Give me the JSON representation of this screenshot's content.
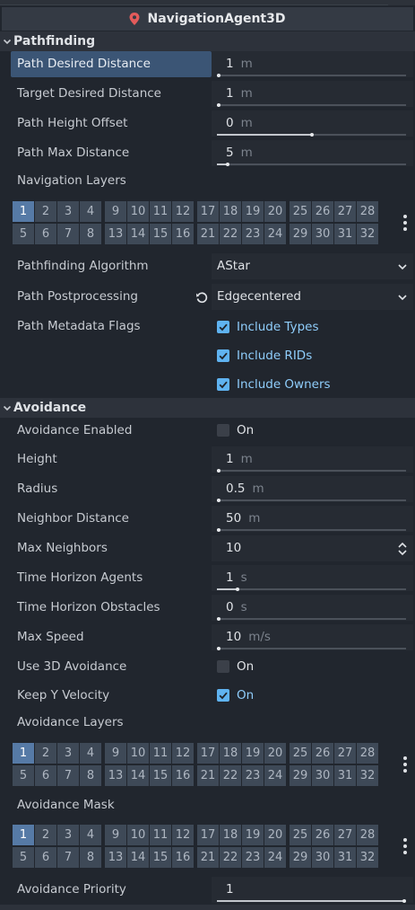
{
  "title": "NavigationAgent3D",
  "sections": {
    "pathfinding": "Pathfinding",
    "avoidance": "Avoidance"
  },
  "pathfinding": {
    "path_desired_distance": {
      "label": "Path Desired Distance",
      "value": "1",
      "unit": "m",
      "fraction": 0.0
    },
    "target_desired_distance": {
      "label": "Target Desired Distance",
      "value": "1",
      "unit": "m",
      "fraction": 0.0
    },
    "path_height_offset": {
      "label": "Path Height Offset",
      "value": "0",
      "unit": "m",
      "fraction": 0.5
    },
    "path_max_distance": {
      "label": "Path Max Distance",
      "value": "5",
      "unit": "m",
      "fraction": 0.05
    },
    "navigation_layers": {
      "label": "Navigation Layers",
      "active": [
        1
      ]
    },
    "algorithm": {
      "label": "Pathfinding Algorithm",
      "value": "AStar"
    },
    "postprocessing": {
      "label": "Path Postprocessing",
      "value": "Edgecentered"
    },
    "metadata_flags": {
      "label": "Path Metadata Flags",
      "options": [
        {
          "label": "Include Types",
          "checked": true
        },
        {
          "label": "Include RIDs",
          "checked": true
        },
        {
          "label": "Include Owners",
          "checked": true
        }
      ]
    }
  },
  "avoidance": {
    "enabled": {
      "label": "Avoidance Enabled",
      "text": "On",
      "checked": false
    },
    "height": {
      "label": "Height",
      "value": "1",
      "unit": "m",
      "fraction": 0.0
    },
    "radius": {
      "label": "Radius",
      "value": "0.5",
      "unit": "m",
      "fraction": 0.0
    },
    "neighbor_distance": {
      "label": "Neighbor Distance",
      "value": "50",
      "unit": "m",
      "fraction": 0.0
    },
    "max_neighbors": {
      "label": "Max Neighbors",
      "value": "10"
    },
    "time_horizon_agents": {
      "label": "Time Horizon Agents",
      "value": "1",
      "unit": "s",
      "fraction": 0.1
    },
    "time_horizon_obstacles": {
      "label": "Time Horizon Obstacles",
      "value": "0",
      "unit": "s",
      "fraction": 0.0
    },
    "max_speed": {
      "label": "Max Speed",
      "value": "10",
      "unit": "m/s",
      "fraction": 0.0
    },
    "use_3d": {
      "label": "Use 3D Avoidance",
      "text": "On",
      "checked": false
    },
    "keep_y_velocity": {
      "label": "Keep Y Velocity",
      "text": "On",
      "checked": true
    },
    "layers": {
      "label": "Avoidance Layers",
      "active": [
        1
      ]
    },
    "mask": {
      "label": "Avoidance Mask",
      "active": [
        1
      ]
    },
    "priority": {
      "label": "Avoidance Priority",
      "value": "1",
      "fraction": 1.0
    }
  },
  "layer_numbers": [
    "1",
    "2",
    "3",
    "4",
    "5",
    "6",
    "7",
    "8",
    "9",
    "10",
    "11",
    "12",
    "13",
    "14",
    "15",
    "16",
    "17",
    "18",
    "19",
    "20",
    "21",
    "22",
    "23",
    "24",
    "25",
    "26",
    "27",
    "28",
    "29",
    "30",
    "31",
    "32"
  ],
  "colors": {
    "accent": "#5fb3f1",
    "layer_on": "#567aa6",
    "highlight": "#3b5575",
    "pin": "#e35b5b"
  }
}
